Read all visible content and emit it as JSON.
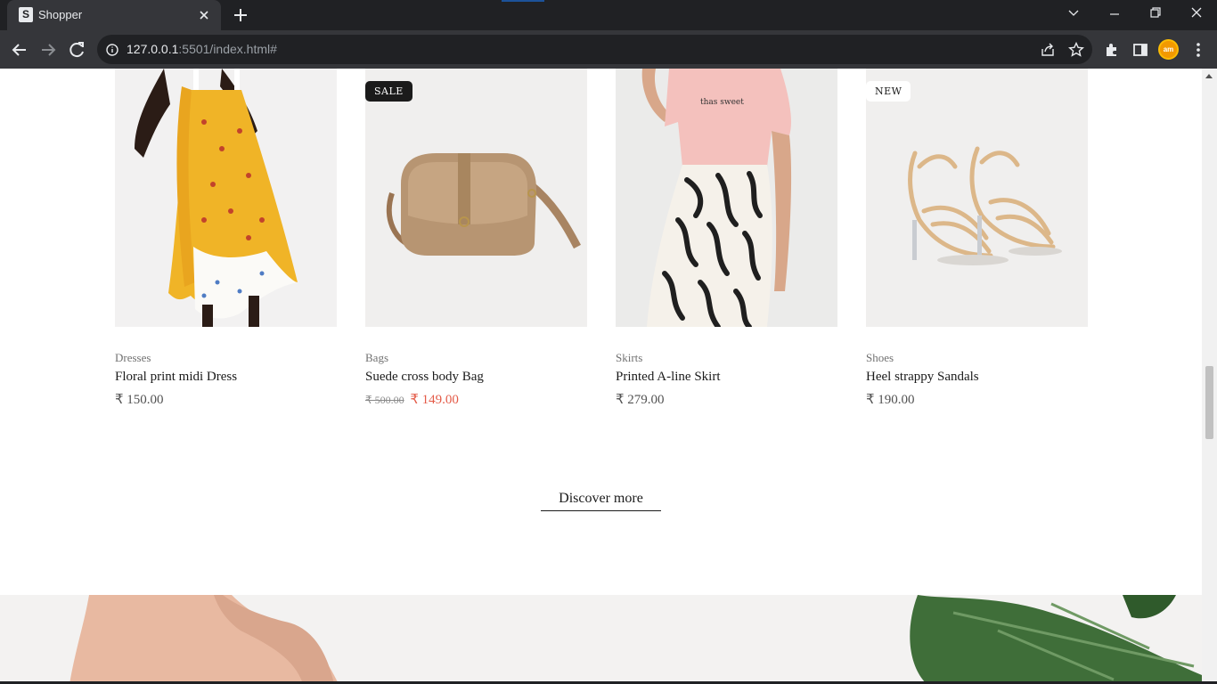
{
  "browser": {
    "tab_title": "Shopper",
    "tab_favicon_letter": "S",
    "url_host": "127.0.0.1",
    "url_path": ":5501/index.html#",
    "profile_initials": "am"
  },
  "products": [
    {
      "category": "Dresses",
      "name": "Floral print midi Dress",
      "price": "₹ 150.00",
      "badge": ""
    },
    {
      "category": "Bags",
      "name": "Suede cross body Bag",
      "old_price": "₹ 500.00",
      "price": "₹ 149.00",
      "badge": "SALE"
    },
    {
      "category": "Skirts",
      "name": "Printed A-line Skirt",
      "price": "₹ 279.00",
      "badge": ""
    },
    {
      "category": "Shoes",
      "name": "Heel strappy Sandals",
      "price": "₹ 190.00",
      "badge": "NEW"
    }
  ],
  "discover_more": "Discover more",
  "colors": {
    "sale_price": "#e45b48",
    "badge_dark": "#1b1b1b",
    "card_bg": "#f1f0ef"
  },
  "icons": [
    "back-icon",
    "forward-icon",
    "reload-icon",
    "info-icon",
    "share-icon",
    "star-icon",
    "extensions-icon",
    "sidepanel-icon",
    "menu-icon"
  ]
}
